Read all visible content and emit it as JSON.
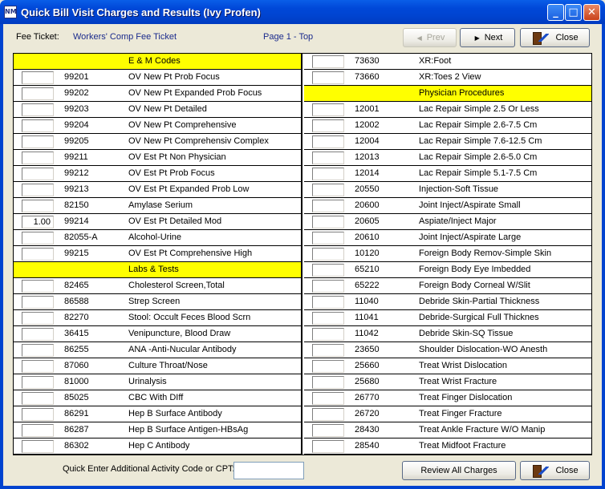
{
  "window": {
    "title": "Quick Bill Visit Charges and Results (Ivy Profen)",
    "app_icon_text": "NM",
    "minimize_glyph": "_",
    "maximize_glyph": "□",
    "close_glyph": "✕"
  },
  "header": {
    "fee_ticket_label": "Fee Ticket:",
    "fee_ticket_value": "Workers' Comp Fee Ticket",
    "page_indicator": "Page 1 - Top",
    "prev_label": "Prev",
    "next_label": "Next",
    "close_label": "Close"
  },
  "left_column": [
    {
      "type": "header",
      "label": "E & M Codes"
    },
    {
      "qty": "",
      "code": "99201",
      "desc": "OV New Pt Prob Focus"
    },
    {
      "qty": "",
      "code": "99202",
      "desc": "OV New Pt Expanded Prob Focus"
    },
    {
      "qty": "",
      "code": "99203",
      "desc": "OV New Pt Detailed"
    },
    {
      "qty": "",
      "code": "99204",
      "desc": "OV New Pt Comprehensive"
    },
    {
      "qty": "",
      "code": "99205",
      "desc": "OV New Pt Comprehensiv Complex"
    },
    {
      "qty": "",
      "code": "99211",
      "desc": "OV Est Pt Non Physician"
    },
    {
      "qty": "",
      "code": "99212",
      "desc": "OV Est Pt Prob Focus"
    },
    {
      "qty": "",
      "code": "99213",
      "desc": "OV Est Pt Expanded Prob Low"
    },
    {
      "qty": "",
      "code": "82150",
      "desc": "Amylase Serium"
    },
    {
      "qty": "1.00",
      "code": "99214",
      "desc": "OV Est Pt Detailed Mod"
    },
    {
      "qty": "",
      "code": "82055-A",
      "desc": "Alcohol-Urine"
    },
    {
      "qty": "",
      "code": "99215",
      "desc": "OV Est Pt Comprehensive High"
    },
    {
      "type": "header",
      "label": "Labs & Tests"
    },
    {
      "qty": "",
      "code": "82465",
      "desc": "Cholesterol Screen,Total"
    },
    {
      "qty": "",
      "code": "86588",
      "desc": "Strep Screen"
    },
    {
      "qty": "",
      "code": "82270",
      "desc": "Stool: Occult Feces Blood Scrn"
    },
    {
      "qty": "",
      "code": "36415",
      "desc": "Venipuncture, Blood Draw"
    },
    {
      "qty": "",
      "code": "86255",
      "desc": "ANA -Anti-Nucular Antibody"
    },
    {
      "qty": "",
      "code": "87060",
      "desc": "Culture Throat/Nose"
    },
    {
      "qty": "",
      "code": "81000",
      "desc": "Urinalysis"
    },
    {
      "qty": "",
      "code": "85025",
      "desc": "CBC  With DIff"
    },
    {
      "qty": "",
      "code": "86291",
      "desc": "Hep B Surface Antibody"
    },
    {
      "qty": "",
      "code": "86287",
      "desc": "Hep B Surface Antigen-HBsAg"
    },
    {
      "qty": "",
      "code": "86302",
      "desc": "Hep C Antibody"
    }
  ],
  "right_column": [
    {
      "qty": "",
      "code": "73630",
      "desc": "XR:Foot"
    },
    {
      "qty": "",
      "code": "73660",
      "desc": "XR:Toes 2 View"
    },
    {
      "type": "header",
      "label": "Physician Procedures"
    },
    {
      "qty": "",
      "code": "12001",
      "desc": "Lac Repair Simple 2.5 Or Less"
    },
    {
      "qty": "",
      "code": "12002",
      "desc": "Lac Repair Simple 2.6-7.5 Cm"
    },
    {
      "qty": "",
      "code": "12004",
      "desc": "Lac Repair Simple 7.6-12.5 Cm"
    },
    {
      "qty": "",
      "code": "12013",
      "desc": "Lac Repair Simple 2.6-5.0 Cm"
    },
    {
      "qty": "",
      "code": "12014",
      "desc": "Lac Repair Simple 5.1-7.5 Cm"
    },
    {
      "qty": "",
      "code": "20550",
      "desc": "Injection-Soft Tissue"
    },
    {
      "qty": "",
      "code": "20600",
      "desc": "Joint Inject/Aspirate Small"
    },
    {
      "qty": "",
      "code": "20605",
      "desc": "Aspiate/Inject Major"
    },
    {
      "qty": "",
      "code": "20610",
      "desc": "Joint Inject/Aspirate Large"
    },
    {
      "qty": "",
      "code": "10120",
      "desc": "Foreign Body Remov-Simple Skin"
    },
    {
      "qty": "",
      "code": "65210",
      "desc": "Foreign Body Eye Imbedded"
    },
    {
      "qty": "",
      "code": "65222",
      "desc": "Foreign Body Corneal W/Slit"
    },
    {
      "qty": "",
      "code": "11040",
      "desc": "Debride Skin-Partial Thickness"
    },
    {
      "qty": "",
      "code": "11041",
      "desc": "Debride-Surgical Full Thicknes"
    },
    {
      "qty": "",
      "code": "11042",
      "desc": "Debride Skin-SQ Tissue"
    },
    {
      "qty": "",
      "code": "23650",
      "desc": "Shoulder Dislocation-WO Anesth"
    },
    {
      "qty": "",
      "code": "25660",
      "desc": "Treat Wrist Dislocation"
    },
    {
      "qty": "",
      "code": "25680",
      "desc": "Treat Wrist Fracture"
    },
    {
      "qty": "",
      "code": "26770",
      "desc": "Treat Finger Dislocation"
    },
    {
      "qty": "",
      "code": "26720",
      "desc": "Treat Finger Fracture"
    },
    {
      "qty": "",
      "code": "28430",
      "desc": "Treat Ankle Fracture W/O Manip"
    },
    {
      "qty": "",
      "code": "28540",
      "desc": "Treat Midfoot Fracture"
    }
  ],
  "footer": {
    "quick_enter_label": "Quick Enter Additional Activity Code or CPT:",
    "quick_enter_value": "",
    "review_label": "Review All Charges",
    "close_label": "Close"
  }
}
